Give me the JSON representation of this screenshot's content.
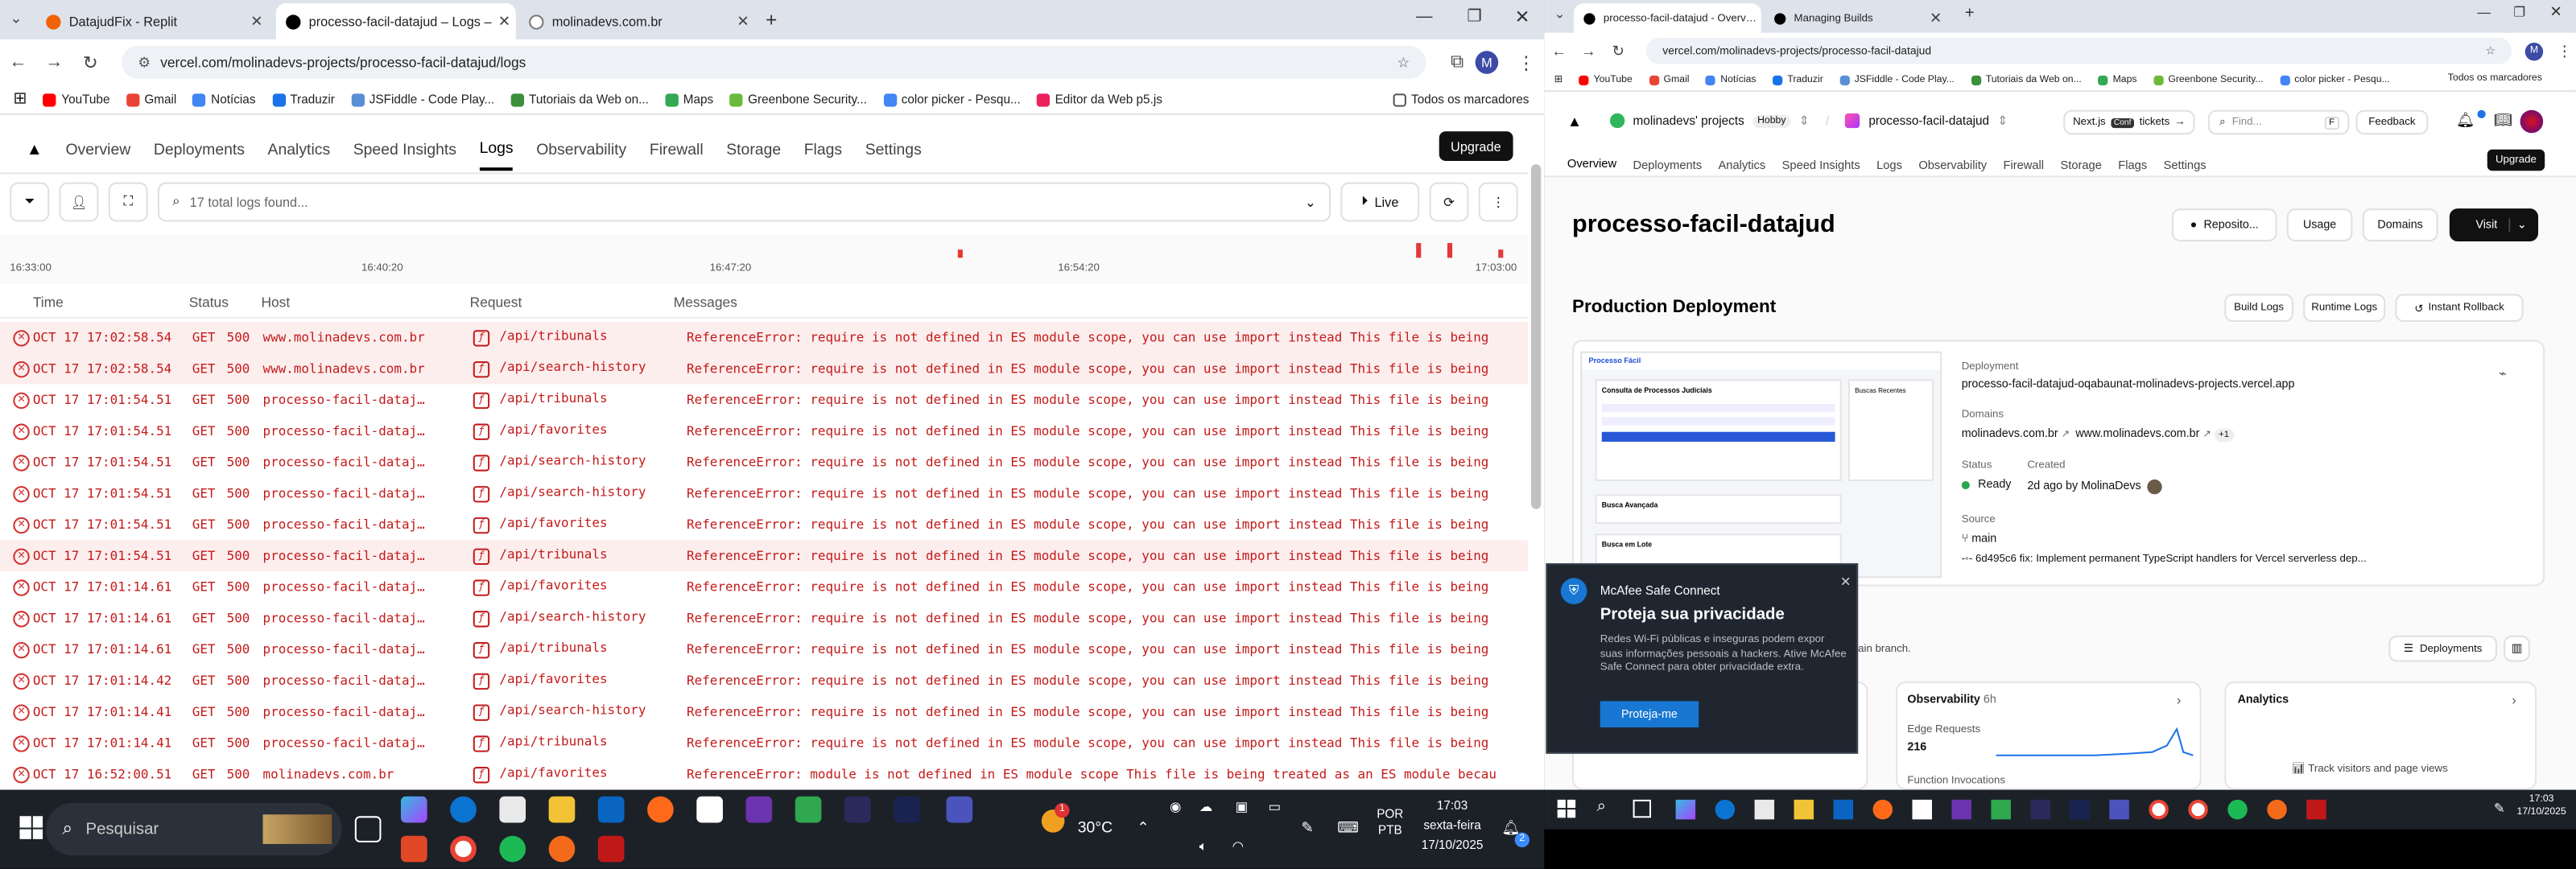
{
  "left_browser": {
    "tabs": [
      {
        "title": "DatajudFix - Replit",
        "color": "#f26207"
      },
      {
        "title": "processo-facil-datajud – Logs –",
        "color": "#000000",
        "active": true
      },
      {
        "title": "molinadevs.com.br",
        "color": "#777777"
      }
    ],
    "url": "vercel.com/molinadevs-projects/processo-facil-datajud/logs",
    "bookmarks": [
      "YouTube",
      "Gmail",
      "Notícias",
      "Traduzir",
      "JSFiddle - Code Play...",
      "Tutoriais da Web on...",
      "Maps",
      "Greenbone Security...",
      "color picker - Pesqu...",
      "Editor da Web p5.js"
    ],
    "bookmarks_folder": "Todos os marcadores",
    "nav": [
      "Overview",
      "Deployments",
      "Analytics",
      "Speed Insights",
      "Logs",
      "Observability",
      "Firewall",
      "Storage",
      "Flags",
      "Settings"
    ],
    "upgrade": "Upgrade",
    "search_placeholder": "17 total logs found...",
    "live": "Live",
    "timeline_ticks": [
      "16:33:00",
      "16:40:20",
      "16:47:20",
      "16:54:20",
      "17:03:00"
    ],
    "columns": [
      "Time",
      "Status",
      "Host",
      "Request",
      "Messages"
    ],
    "rows": [
      [
        "OCT 17 17:02:58.54",
        "GET",
        "500",
        "www.molinadevs.com.br",
        "/api/tribunals",
        "ReferenceError: require is not defined in ES module scope, you can use import instead This file is being"
      ],
      [
        "OCT 17 17:02:58.54",
        "GET",
        "500",
        "www.molinadevs.com.br",
        "/api/search-history",
        "ReferenceError: require is not defined in ES module scope, you can use import instead This file is being"
      ],
      [
        "OCT 17 17:01:54.51",
        "GET",
        "500",
        "processo-facil-dataj…",
        "/api/tribunals",
        "ReferenceError: require is not defined in ES module scope, you can use import instead This file is being"
      ],
      [
        "OCT 17 17:01:54.51",
        "GET",
        "500",
        "processo-facil-dataj…",
        "/api/favorites",
        "ReferenceError: require is not defined in ES module scope, you can use import instead This file is being"
      ],
      [
        "OCT 17 17:01:54.51",
        "GET",
        "500",
        "processo-facil-dataj…",
        "/api/search-history",
        "ReferenceError: require is not defined in ES module scope, you can use import instead This file is being"
      ],
      [
        "OCT 17 17:01:54.51",
        "GET",
        "500",
        "processo-facil-dataj…",
        "/api/search-history",
        "ReferenceError: require is not defined in ES module scope, you can use import instead This file is being"
      ],
      [
        "OCT 17 17:01:54.51",
        "GET",
        "500",
        "processo-facil-dataj…",
        "/api/favorites",
        "ReferenceError: require is not defined in ES module scope, you can use import instead This file is being"
      ],
      [
        "OCT 17 17:01:54.51",
        "GET",
        "500",
        "processo-facil-dataj…",
        "/api/tribunals",
        "ReferenceError: require is not defined in ES module scope, you can use import instead This file is being"
      ],
      [
        "OCT 17 17:01:14.61",
        "GET",
        "500",
        "processo-facil-dataj…",
        "/api/favorites",
        "ReferenceError: require is not defined in ES module scope, you can use import instead This file is being"
      ],
      [
        "OCT 17 17:01:14.61",
        "GET",
        "500",
        "processo-facil-dataj…",
        "/api/search-history",
        "ReferenceError: require is not defined in ES module scope, you can use import instead This file is being"
      ],
      [
        "OCT 17 17:01:14.61",
        "GET",
        "500",
        "processo-facil-dataj…",
        "/api/tribunals",
        "ReferenceError: require is not defined in ES module scope, you can use import instead This file is being"
      ],
      [
        "OCT 17 17:01:14.42",
        "GET",
        "500",
        "processo-facil-dataj…",
        "/api/favorites",
        "ReferenceError: require is not defined in ES module scope, you can use import instead This file is being"
      ],
      [
        "OCT 17 17:01:14.41",
        "GET",
        "500",
        "processo-facil-dataj…",
        "/api/search-history",
        "ReferenceError: require is not defined in ES module scope, you can use import instead This file is being"
      ],
      [
        "OCT 17 17:01:14.41",
        "GET",
        "500",
        "processo-facil-dataj…",
        "/api/tribunals",
        "ReferenceError: require is not defined in ES module scope, you can use import instead This file is being"
      ],
      [
        "OCT 17 16:52:00.51",
        "GET",
        "500",
        "molinadevs.com.br",
        "/api/favorites",
        "ReferenceError: module is not defined in ES module scope This file is being treated as an ES module becau"
      ]
    ]
  },
  "right_browser": {
    "tabs": [
      {
        "title": "processo-facil-datajud - Overv…",
        "active": true
      },
      {
        "title": "Managing Builds"
      }
    ],
    "url": "vercel.com/molinadevs-projects/processo-facil-datajud",
    "bookmarks": [
      "YouTube",
      "Gmail",
      "Notícias",
      "Traduzir",
      "JSFiddle - Code Play...",
      "Tutoriais da Web on...",
      "Maps",
      "Greenbone Security...",
      "color picker - Pesqu..."
    ],
    "bookmarks_folder": "Todos os marcadores",
    "team": "molinadevs' projects",
    "plan": "Hobby",
    "project": "processo-facil-datajud",
    "next_tickets": "Next.js",
    "next_badge": "Conf",
    "tickets": "tickets",
    "find": "Find...",
    "find_key": "F",
    "feedback": "Feedback",
    "nav": [
      "Overview",
      "Deployments",
      "Analytics",
      "Speed Insights",
      "Logs",
      "Observability",
      "Firewall",
      "Storage",
      "Flags",
      "Settings"
    ],
    "upgrade": "Upgrade",
    "title": "processo-facil-datajud",
    "buttons": [
      "Reposito...",
      "Usage",
      "Domains",
      "Visit"
    ],
    "production_title": "Production Deployment",
    "prod_buttons": [
      "Build Logs",
      "Runtime Logs",
      "Instant Rollback"
    ],
    "preview": {
      "brand": "Processo Fácil",
      "section1": "Consulta de Processos Judiciais",
      "section2": "Busca Avançada",
      "section3": "Busca em Lote",
      "recent": "Buscas Recentes"
    },
    "deployment_label": "Deployment",
    "deployment_value": "processo-facil-datajud-oqabaunat-molinadevs-projects.vercel.app",
    "domains_label": "Domains",
    "domains": [
      "molinadevs.com.br",
      "www.molinadevs.com.br"
    ],
    "domains_more": "+1",
    "status_label": "Status",
    "status_value": "Ready",
    "created_label": "Created",
    "created_value": "2d ago by MolinaDevs",
    "source_label": "Source",
    "branch": "main",
    "commit_hash": "6d495c6",
    "commit_msg": "fix: Implement permanent TypeScript handlers for Vercel serverless dep...",
    "branch_text": "ain branch.",
    "deployments_btn": "Deployments",
    "observability_title": "Observability",
    "observability_range": "6h",
    "edge_requests_label": "Edge Requests",
    "edge_requests_value": "216",
    "function_invocations": "Function Invocations",
    "analytics_title": "Analytics",
    "analytics_text": "Track visitors and page views"
  },
  "mcafee": {
    "brand": "McAfee Safe Connect",
    "title": "Proteja sua privacidade",
    "body": "Redes Wi-Fi públicas e inseguras podem expor suas informações pessoais a hackers. Ative McAfee Safe Connect para obter privacidade extra.",
    "button": "Proteja-me"
  },
  "taskbar_left": {
    "search": "Pesquisar",
    "temp": "30°C",
    "weather_badge": "1",
    "lang1": "POR",
    "lang2": "PTB",
    "time": "17:03",
    "day": "sexta-feira",
    "date": "17/10/2025",
    "notif": "2"
  },
  "taskbar_right": {
    "time": "17:03",
    "date": "17/10/2025"
  }
}
